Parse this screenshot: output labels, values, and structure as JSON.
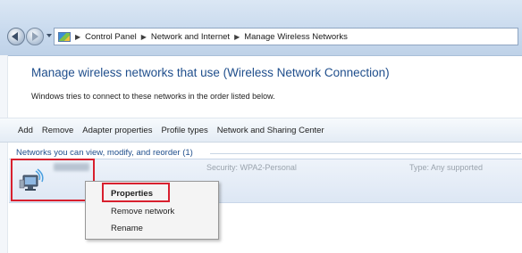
{
  "address_bar": {
    "breadcrumbs": [
      "Control Panel",
      "Network and Internet",
      "Manage Wireless Networks"
    ]
  },
  "main": {
    "heading": "Manage wireless networks that use (Wireless Network Connection)",
    "subtext": "Windows tries to connect to these networks in the order listed below."
  },
  "toolbar": {
    "items": [
      "Add",
      "Remove",
      "Adapter properties",
      "Profile types",
      "Network and Sharing Center"
    ]
  },
  "networks": {
    "header": "Networks you can view, modify, and reorder (1)",
    "rows": [
      {
        "security": "Security: WPA2-Personal",
        "type": "Type: Any supported"
      }
    ]
  },
  "context_menu": {
    "items": [
      "Properties",
      "Remove network",
      "Rename"
    ]
  },
  "colors": {
    "highlight_box": "#d8202e",
    "heading": "#1f4e8c"
  }
}
